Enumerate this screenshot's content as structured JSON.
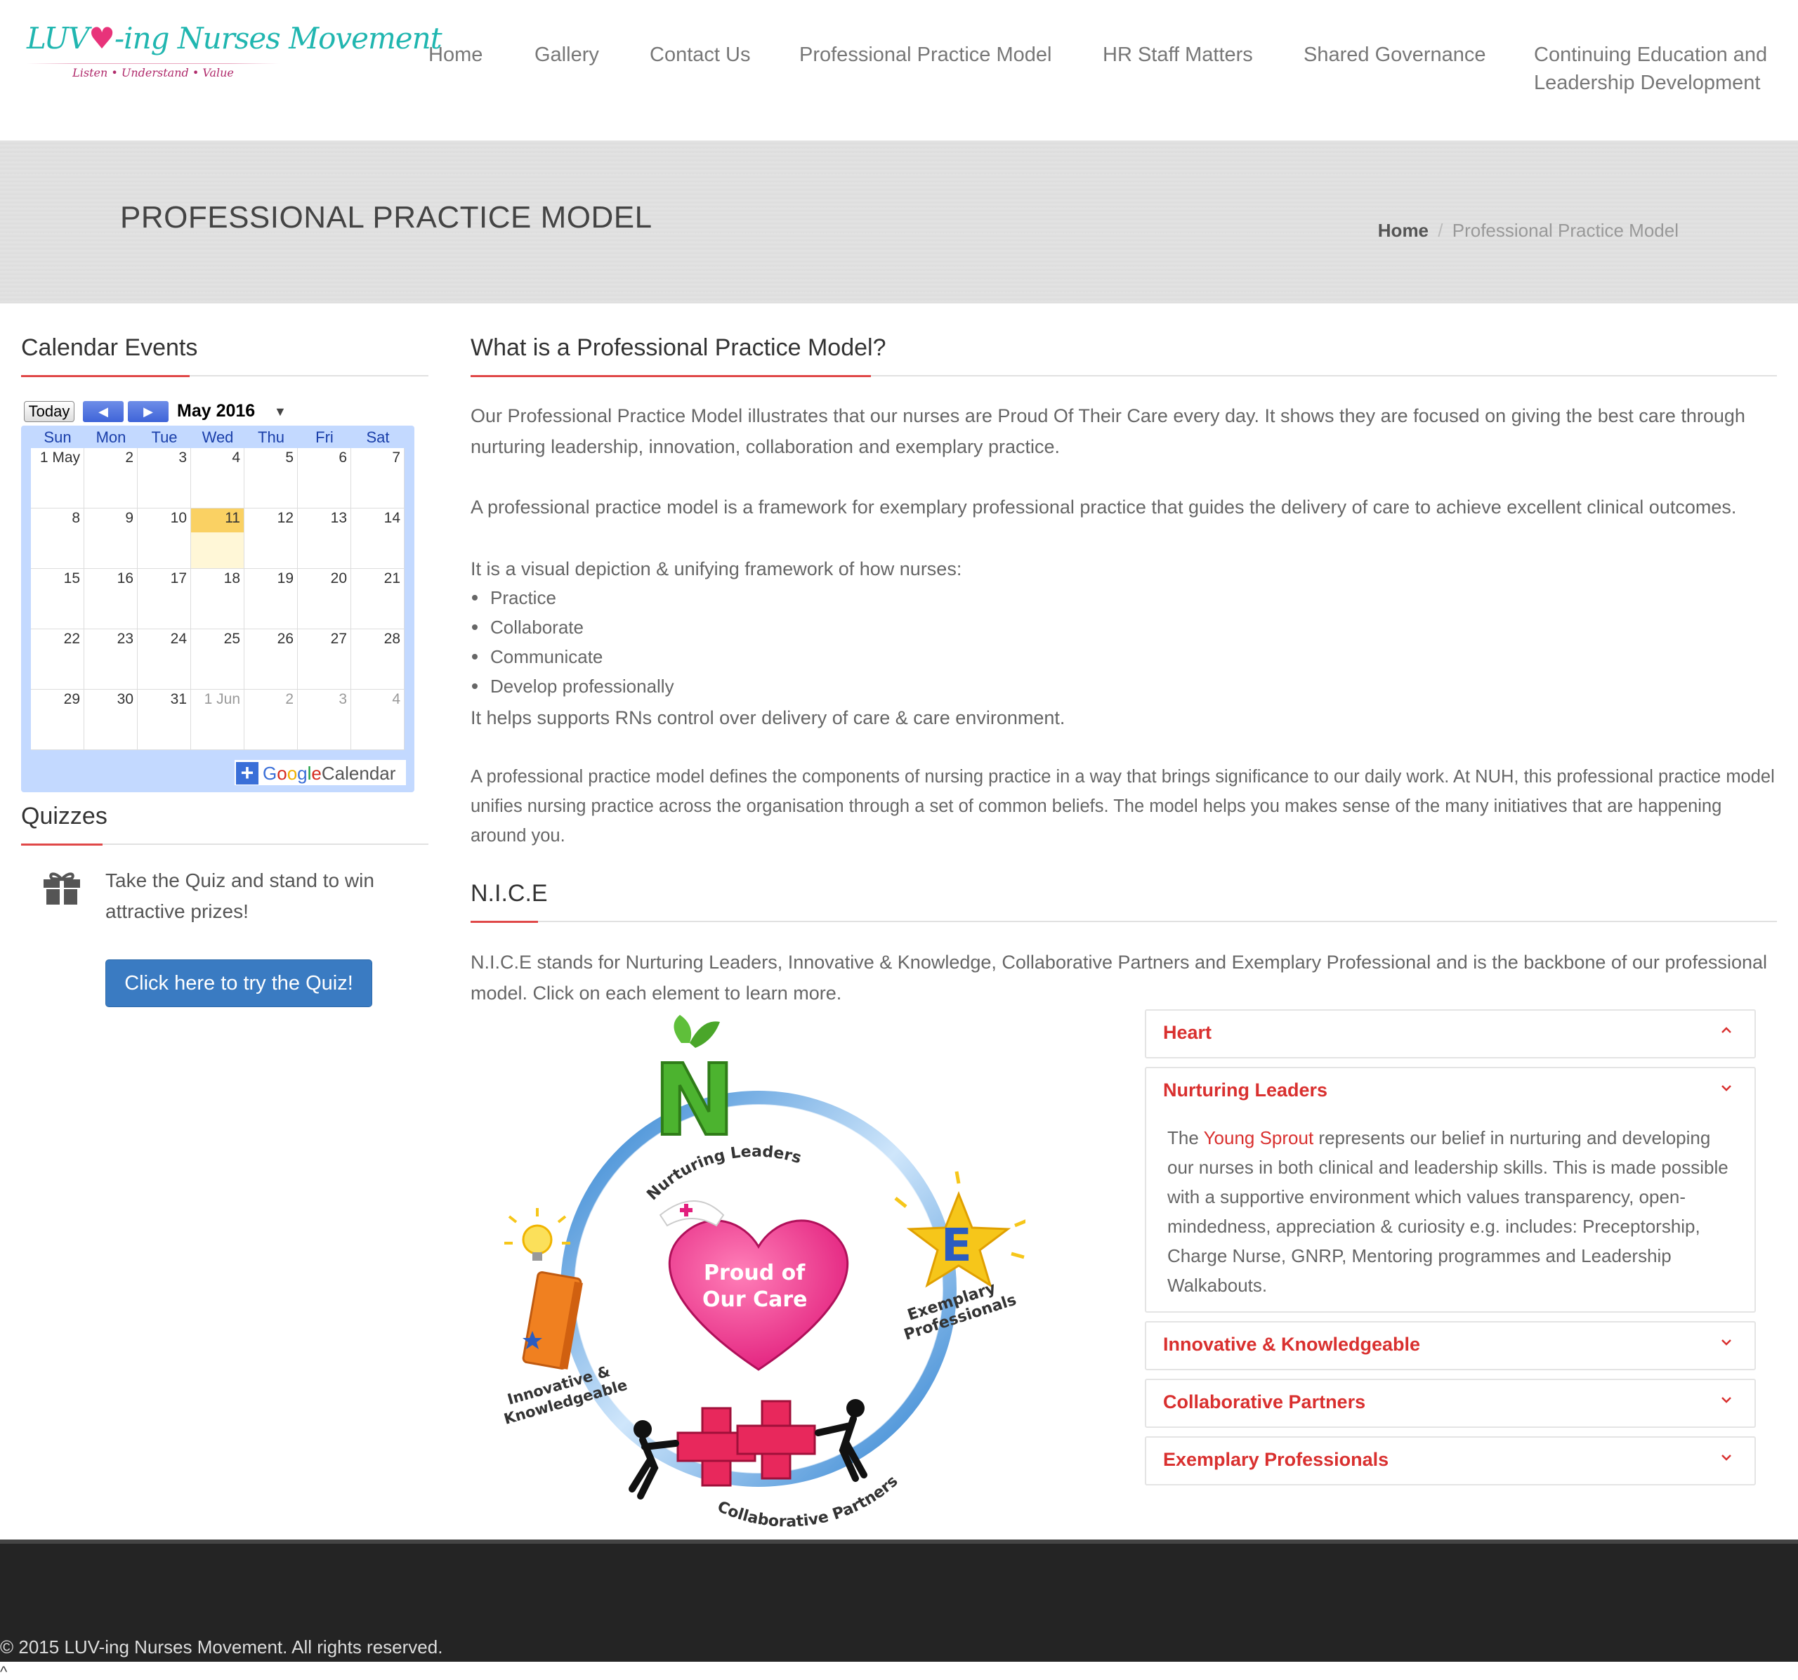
{
  "brand": {
    "title_pre": "LUV",
    "title_post": "-ing Nurses Movement",
    "tagline": "Listen • Understand • Value"
  },
  "nav": {
    "items": [
      "Home",
      "Gallery",
      "Contact Us",
      "Professional Practice Model",
      "HR Staff Matters",
      "Shared Governance"
    ],
    "last_line1": "Continuing Education and",
    "last_line2": "Leadership Development"
  },
  "banner": {
    "title": "PROFESSIONAL PRACTICE MODEL",
    "breadcrumb_home": "Home",
    "breadcrumb_sep": "/",
    "breadcrumb_current": "Professional Practice Model"
  },
  "sidebar": {
    "calendar_title": "Calendar Events",
    "calendar": {
      "today_label": "Today",
      "prev_icon": "◀",
      "next_icon": "▶",
      "month_label": "May 2016",
      "dropdown_icon": "▼",
      "days_of_week": [
        "Sun",
        "Mon",
        "Tue",
        "Wed",
        "Thu",
        "Fri",
        "Sat"
      ],
      "weeks": [
        [
          "1 May",
          "2",
          "3",
          "4",
          "5",
          "6",
          "7"
        ],
        [
          "8",
          "9",
          "10",
          "11",
          "12",
          "13",
          "14"
        ],
        [
          "15",
          "16",
          "17",
          "18",
          "19",
          "20",
          "21"
        ],
        [
          "22",
          "23",
          "24",
          "25",
          "26",
          "27",
          "28"
        ],
        [
          "29",
          "30",
          "31",
          "1 Jun",
          "2",
          "3",
          "4"
        ]
      ],
      "today_date": "11",
      "footer_plus": "+",
      "footer_google": "Google",
      "footer_calendar": "Calendar"
    },
    "quizzes_title": "Quizzes",
    "quiz_icon": "gift-icon",
    "quiz_text": "Take the Quiz and stand to win attractive prizes!",
    "quiz_button": "Click here to try the Quiz!"
  },
  "main": {
    "section1_title": "What is a Professional Practice Model?",
    "p1": "Our Professional Practice Model illustrates that our nurses are Proud Of Their Care every day. It shows they are focused on giving the best care through nurturing leadership, innovation, collaboration and exemplary practice.",
    "p2": "A professional practice model is a framework for exemplary professional practice that guides the delivery of care to achieve excellent clinical outcomes.",
    "p3": "It is a visual depiction & unifying framework of how nurses:",
    "bullets": [
      "Practice",
      "Collaborate",
      "Communicate",
      "Develop professionally"
    ],
    "p4": "It helps supports RNs control over delivery of care & care environment.",
    "p5": "A professional practice model defines the components of nursing practice in a way that brings significance to our daily work. At NUH, this professional practice model unifies nursing practice across the organisation through a set of common beliefs. The model helps you makes sense of the many initiatives that are happening around you.",
    "section2_title": "N.I.C.E",
    "p6": "N.I.C.E stands for Nurturing Leaders, Innovative & Knowledge, Collaborative Partners and Exemplary Professional and is the backbone of our professional model. Click on each element to learn more."
  },
  "diagram": {
    "label_nurturing": "Nurturing Leaders",
    "label_exemplary_1": "Exemplary",
    "label_exemplary_2": "Professionals",
    "label_innovative_1": "Innovative &",
    "label_innovative_2": "Knowledgeable",
    "label_collaborative": "Collaborative Partners",
    "heart_line1": "Proud of",
    "heart_line2": "Our Care",
    "letter_n": "N",
    "letter_e": "E"
  },
  "accordion": {
    "items": [
      {
        "title": "Heart"
      },
      {
        "title": "Nurturing Leaders",
        "body_pre": "The ",
        "body_link": "Young Sprout",
        "body_post": " represents our belief in nurturing and developing our nurses in both clinical and leadership skills. This is made possible with a supportive environment which values transparency, open-mindedness, appreciation & curiosity e.g. includes: Preceptorship, Charge Nurse, GNRP, Mentoring programmes and Leadership Walkabouts."
      },
      {
        "title": "Innovative & Knowledgeable"
      },
      {
        "title": "Collaborative Partners"
      },
      {
        "title": "Exemplary Professionals"
      }
    ]
  },
  "footer": {
    "copyright": "© 2015 LUV-ing Nurses Movement. All rights reserved.",
    "scroll_top": "^"
  },
  "colors": {
    "accent_red": "#d9302f",
    "logo_teal": "#20b6b0",
    "logo_pink": "#e8337a",
    "button_blue": "#3a7bc2",
    "footer_bg": "#242424"
  }
}
